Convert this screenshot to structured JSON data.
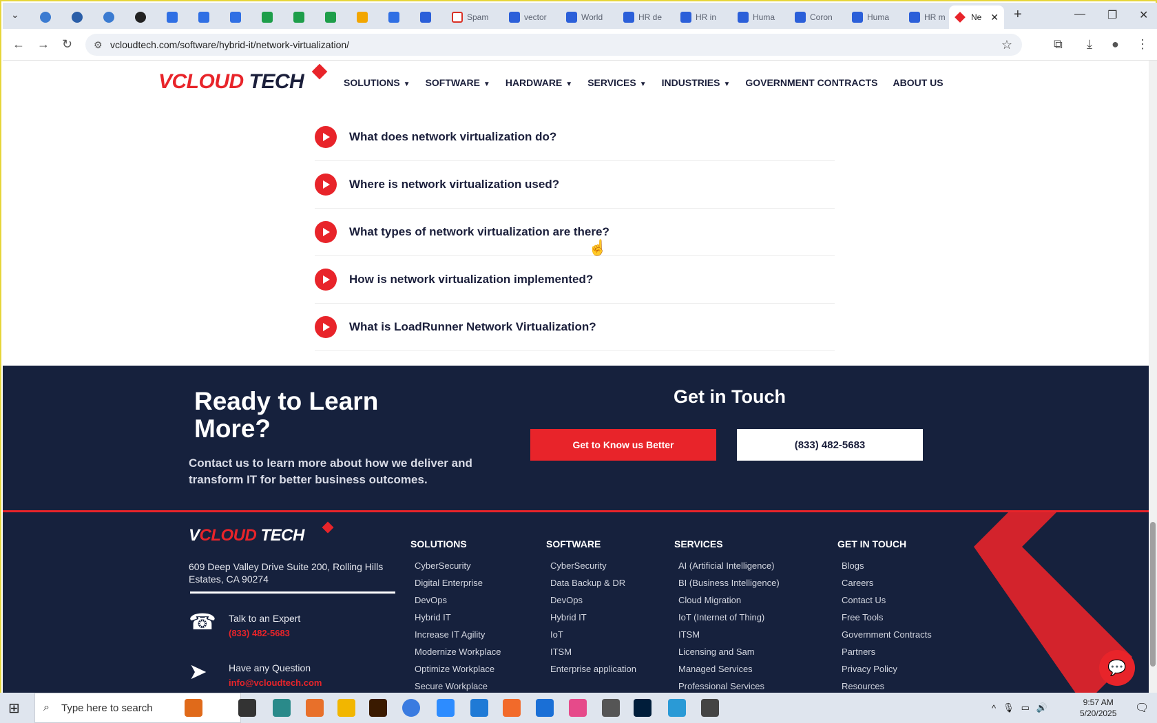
{
  "browser": {
    "tabs": [
      {
        "title": "",
        "icon": "circle-icon"
      },
      {
        "title": "",
        "icon": "wordpress-icon"
      },
      {
        "title": "",
        "icon": "circle-icon"
      },
      {
        "title": "",
        "icon": "openai-icon"
      },
      {
        "title": "",
        "icon": "docs-icon"
      },
      {
        "title": "",
        "icon": "docs-icon"
      },
      {
        "title": "",
        "icon": "docs-icon"
      },
      {
        "title": "",
        "icon": "sheets-icon"
      },
      {
        "title": "",
        "icon": "sheets-icon"
      },
      {
        "title": "",
        "icon": "sheets-icon"
      },
      {
        "title": "",
        "icon": "slides-icon"
      },
      {
        "title": "",
        "icon": "docs-icon"
      },
      {
        "title": "",
        "icon": "word-icon"
      },
      {
        "title": "Spam",
        "icon": "gmail-icon"
      },
      {
        "title": "vector",
        "icon": "page-icon"
      },
      {
        "title": "World",
        "icon": "page-icon"
      },
      {
        "title": "HR de",
        "icon": "page-icon"
      },
      {
        "title": "HR in",
        "icon": "page-icon"
      },
      {
        "title": "Huma",
        "icon": "page-icon"
      },
      {
        "title": "Coron",
        "icon": "page-icon"
      },
      {
        "title": "Huma",
        "icon": "page-icon"
      },
      {
        "title": "HR m",
        "icon": "page-icon"
      }
    ],
    "active_tab": {
      "title": "Ne"
    },
    "url": "vcloudtech.com/software/hybrid-it/network-virtualization/"
  },
  "header": {
    "logo": {
      "v": "V",
      "cloud": "CLOUD",
      "tech": " TECH"
    },
    "nav": [
      {
        "label": "SOLUTIONS",
        "dropdown": true
      },
      {
        "label": "SOFTWARE",
        "dropdown": true
      },
      {
        "label": "HARDWARE",
        "dropdown": true
      },
      {
        "label": "SERVICES",
        "dropdown": true
      },
      {
        "label": "INDUSTRIES",
        "dropdown": true
      },
      {
        "label": "GOVERNMENT CONTRACTS",
        "dropdown": false
      },
      {
        "label": "ABOUT US",
        "dropdown": false
      }
    ]
  },
  "faq": [
    "What does network virtualization do?",
    "Where is network virtualization used?",
    "What types of network virtualization are there?",
    "How is network virtualization implemented?",
    " What is LoadRunner Network Virtualization?"
  ],
  "cta": {
    "title": "Ready to Learn More?",
    "text": "Contact us to learn more about how we deliver and transform IT for better business outcomes.",
    "get_in_touch": "Get in Touch",
    "know_button": "Get to Know us Better",
    "phone_button": "(833) 482-5683"
  },
  "footer": {
    "address": "609 Deep Valley Drive Suite 200, Rolling Hills Estates, CA 90274",
    "expert_label": "Talk to an Expert",
    "expert_phone": "(833) 482-5683",
    "question_label": "Have any Question",
    "question_email": "info@vcloudtech.com",
    "columns": [
      {
        "title": "SOLUTIONS",
        "items": [
          "CyberSecurity",
          "Digital Enterprise",
          "DevOps",
          "Hybrid IT",
          "Increase IT Agility",
          "Modernize Workplace",
          "Optimize Workplace",
          "Secure Workplace"
        ]
      },
      {
        "title": "SOFTWARE",
        "items": [
          "CyberSecurity",
          "Data Backup & DR",
          "DevOps",
          "Hybrid IT",
          "IoT",
          "ITSM",
          "Enterprise application"
        ]
      },
      {
        "title": "SERVICES",
        "items": [
          "AI (Artificial Intelligence)",
          "BI (Business Intelligence)",
          "Cloud Migration",
          "IoT (Internet of Thing)",
          "ITSM",
          "Licensing and Sam",
          "Managed Services",
          "Professional Services"
        ]
      },
      {
        "title": "GET IN TOUCH",
        "items": [
          "Blogs",
          "Careers",
          "Contact Us",
          "Free Tools",
          "Government Contracts",
          "Partners",
          "Privacy Policy",
          "Resources"
        ]
      }
    ]
  },
  "taskbar": {
    "search_placeholder": "Type here to search",
    "time": "9:57 AM",
    "date": "5/20/2025"
  },
  "colors": {
    "accent": "#e8242a",
    "navy": "#16213d",
    "text": "#1b1f3b"
  }
}
